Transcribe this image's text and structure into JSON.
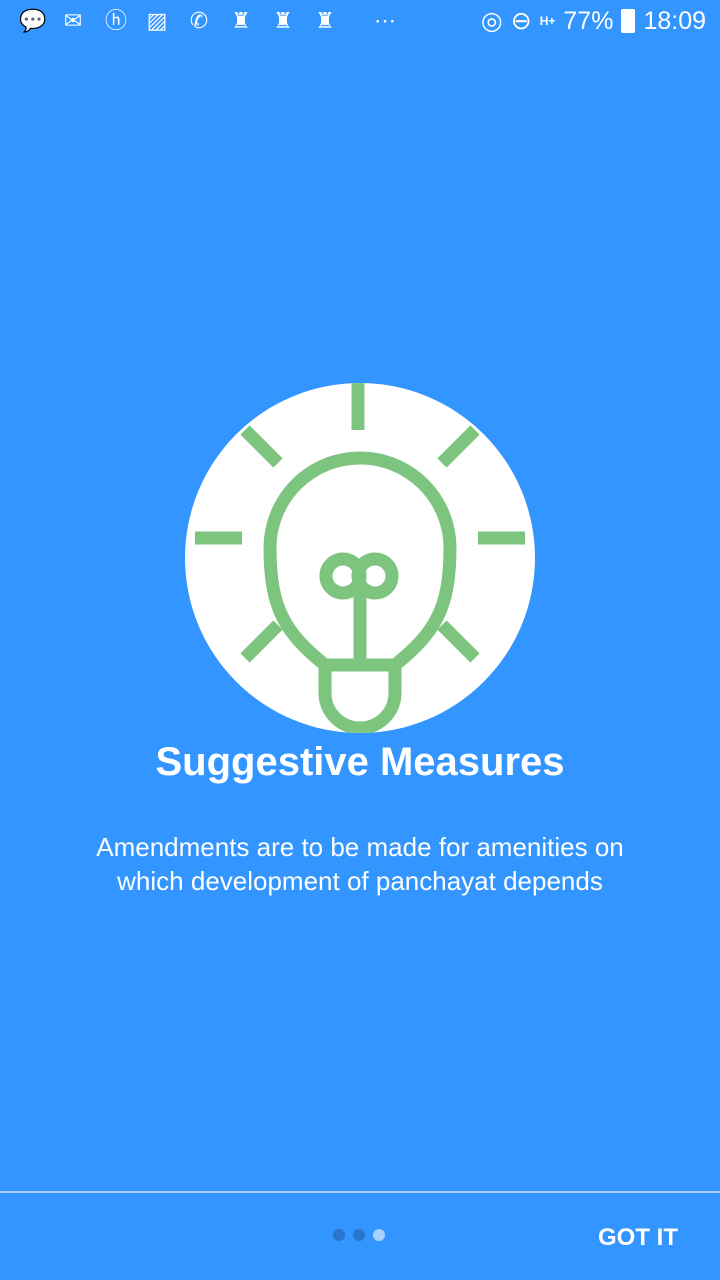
{
  "status_bar": {
    "icons": [
      "message-icon",
      "gmail-icon",
      "hike-icon",
      "gallery-icon",
      "whatsapp-icon",
      "app-crown-icon",
      "app-crown-icon",
      "app-crown-icon",
      "more-icon"
    ],
    "right_icons": [
      "hotspot-icon",
      "do-not-disturb-icon",
      "signal-icon"
    ],
    "network": "H+",
    "battery": "77%",
    "time": "18:09"
  },
  "slide": {
    "title": "Suggestive Measures",
    "description": "Amendments are to be made for amenities on which development of panchayat depends",
    "icon": "lightbulb-icon",
    "icon_color": "#7DC57F",
    "background": "#3395FF"
  },
  "pager": {
    "count": 3,
    "active_index": 2
  },
  "footer": {
    "got_it_label": "GOT IT"
  }
}
